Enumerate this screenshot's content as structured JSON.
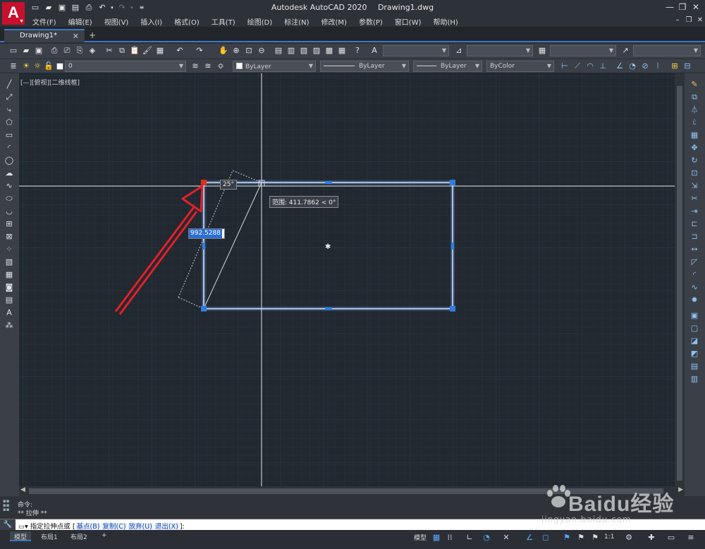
{
  "app": {
    "title": "Autodesk AutoCAD 2020",
    "filename": "Drawing1.dwg",
    "logo_letter": "A"
  },
  "menu": [
    "文件(F)",
    "编辑(E)",
    "视图(V)",
    "插入(I)",
    "格式(O)",
    "工具(T)",
    "绘图(D)",
    "标注(N)",
    "修改(M)",
    "参数(P)",
    "窗口(W)",
    "帮助(H)"
  ],
  "tabs": {
    "active": "Drawing1*",
    "close_glyph": "✕",
    "new_glyph": "+"
  },
  "layer_bar": {
    "layer_value": "0",
    "color": "ByLayer",
    "linetype": "ByLayer",
    "lineweight": "ByLayer",
    "plotstyle": "ByColor"
  },
  "viewport_label": "[—][俯视][二维线框]",
  "dynamic_input": {
    "angle": "25°",
    "range": "范围: 411.7862 < 0°",
    "distance": "992.5288"
  },
  "command": {
    "history": [
      "命令:",
      "** 拉伸 **"
    ],
    "prompt": "指定拉伸点或",
    "options": [
      {
        "label": "基点(B)"
      },
      {
        "label": "复制(C)"
      },
      {
        "label": "放弃(U)"
      },
      {
        "label": "退出(X)"
      }
    ],
    "prompt_end": "]:"
  },
  "layouts": [
    "模型",
    "布局1",
    "布局2"
  ],
  "status": {
    "model": "模型",
    "scale": "1:1"
  },
  "watermark": {
    "text": "Baidu经验",
    "sub": "jingyan.baidu.com"
  },
  "colors": {
    "canvas_bg": "#212830",
    "grid": "#2b3440",
    "selection": "#8fb8ff",
    "grip": "#2f7de0",
    "hot_grip": "#e03020",
    "arrow": "#e0202a",
    "accent": "#3a78c8"
  },
  "icons": {
    "qat": [
      "new-icon",
      "open-icon",
      "save-icon",
      "saveas-icon",
      "print-icon",
      "undo-icon",
      "redo-icon",
      "more-icon"
    ],
    "left_palette": [
      "line-icon",
      "xline-icon",
      "polyline-icon",
      "polygon-icon",
      "rectangle-icon",
      "arc-icon",
      "circle-icon",
      "revcloud-icon",
      "spline-icon",
      "ellipse-icon",
      "ellipse-arc-icon",
      "insert-block-icon",
      "make-block-icon",
      "point-icon",
      "hatch-icon",
      "gradient-icon",
      "region-icon",
      "table-icon",
      "mtext-icon",
      "add-selected-icon"
    ],
    "right_palette": [
      "erase-icon",
      "copy-icon",
      "mirror-icon",
      "offset-icon",
      "array-icon",
      "move-icon",
      "rotate-icon",
      "scale-icon",
      "stretch-icon",
      "trim-icon",
      "extend-icon",
      "break-at-point-icon",
      "break-icon",
      "join-icon",
      "chamfer-icon",
      "fillet-icon",
      "blend-icon",
      "explode-icon"
    ]
  }
}
